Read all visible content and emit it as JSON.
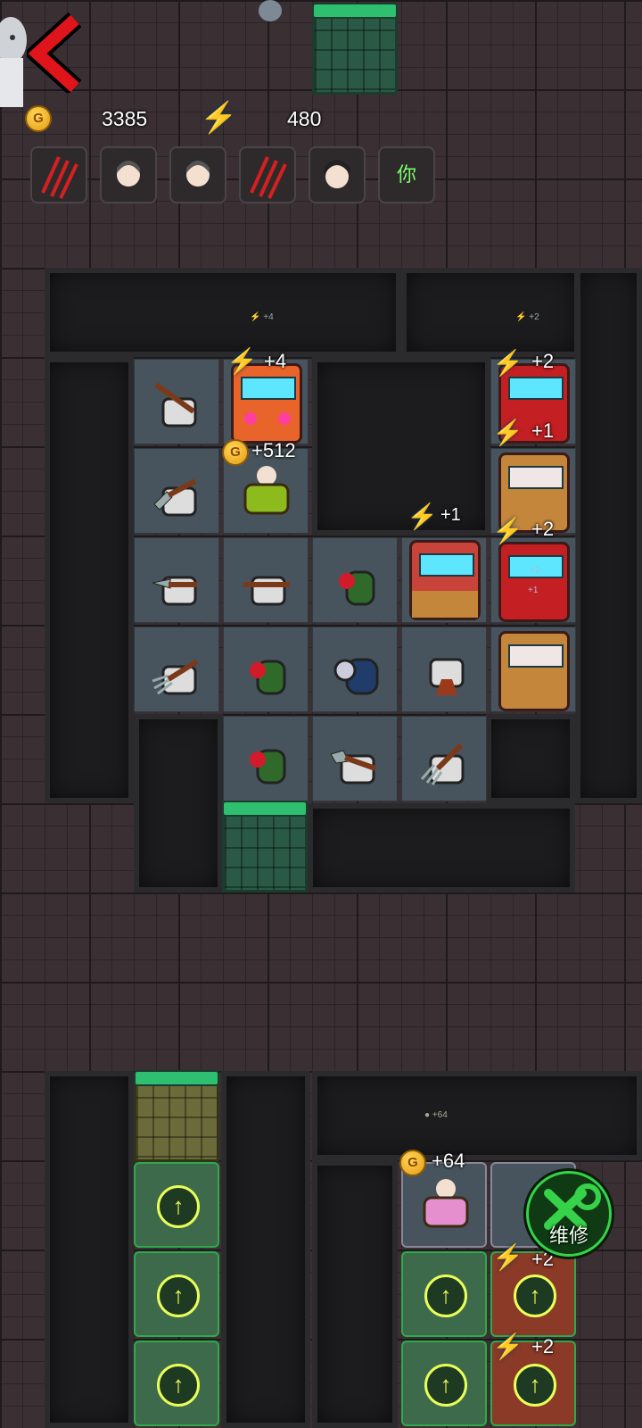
{
  "hud": {
    "gold": "3385",
    "energy": "480",
    "coin_symbol": "G",
    "back_icon": "chevron-left-icon",
    "slots": [
      {
        "icon": "claw-marks-icon",
        "text": ""
      },
      {
        "icon": "girl-face-icon",
        "text": ""
      },
      {
        "icon": "girl-face-icon",
        "text": ""
      },
      {
        "icon": "claw-marks-icon",
        "text": ""
      },
      {
        "icon": "boy-face-icon",
        "text": ""
      },
      {
        "icon": "player-face-icon",
        "text": "你"
      }
    ]
  },
  "room_main": {
    "energy_small_left": "+4",
    "energy_small_right": "+2",
    "arcade_top_bonus": "+4",
    "bed_gold_bonus": "+512",
    "right_col_bonuses": [
      "+2",
      "+1",
      "+2"
    ],
    "middle_machine_bonus": "+1",
    "machine_overlay_1": "+2",
    "machine_overlay_2": "+1"
  },
  "room_bottom": {
    "small_gold": "+64",
    "bed_gold_bonus": "+64",
    "machine_bonuses": [
      "+2",
      "+2"
    ],
    "repair_label": "维修",
    "upgrade_symbol": "↑"
  },
  "colors": {
    "accent_green": "#2ec070",
    "energy_blue": "#4fb9ff",
    "back_red": "#e0141b",
    "repair_green": "#36d34a"
  }
}
